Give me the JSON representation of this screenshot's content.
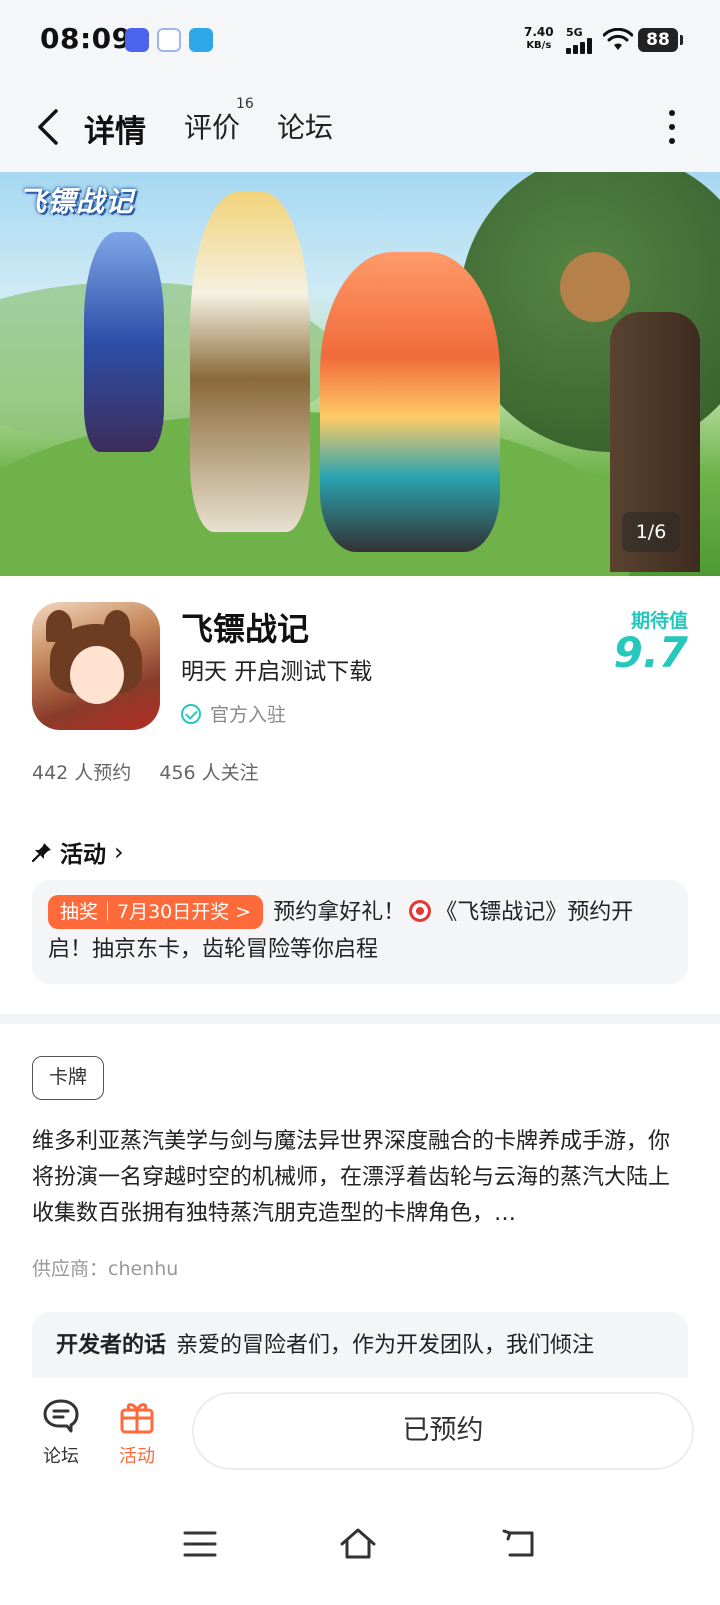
{
  "status_bar": {
    "time": "08:09",
    "net_speed_value": "7.40",
    "net_speed_unit": "KB/s",
    "network": "5G",
    "battery": "88"
  },
  "nav": {
    "tabs": [
      {
        "label": "详情",
        "active": true
      },
      {
        "label": "评价",
        "badge": "16"
      },
      {
        "label": "论坛"
      }
    ]
  },
  "banner": {
    "logo_text": "飞镖战记",
    "counter": "1/6"
  },
  "app": {
    "name": "飞镖战记",
    "status": "明天 开启测试下载",
    "official": "官方入驻",
    "expect_label": "期待值",
    "expect_value": "9.7",
    "reservations": "442 人预约",
    "followers": "456 人关注"
  },
  "activity": {
    "heading": "活动",
    "badge": "抽奖｜7月30日开奖 >",
    "text_before": "预约拿好礼！",
    "text_after": "《飞镖战记》预约开启！抽京东卡，齿轮冒险等你启程"
  },
  "details": {
    "tag": "卡牌",
    "description": "维多利亚蒸汽美学与剑与魔法异世界深度融合的卡牌养成手游，你将扮演一名穿越时空的机械师，在漂浮着齿轮与云海的蒸汽大陆上收集数百张拥有独特蒸汽朋克造型的卡牌角色，…",
    "supplier": "供应商：chenhu",
    "dev_title": "开发者的话",
    "dev_text": "亲爱的冒险者们，作为开发团队，我们倾注"
  },
  "bottom_bar": {
    "forum_label": "论坛",
    "activity_label": "活动",
    "reserve_label": "已预约"
  },
  "colors": {
    "accent": "#26c7bc",
    "orange": "#ff6a3a"
  }
}
